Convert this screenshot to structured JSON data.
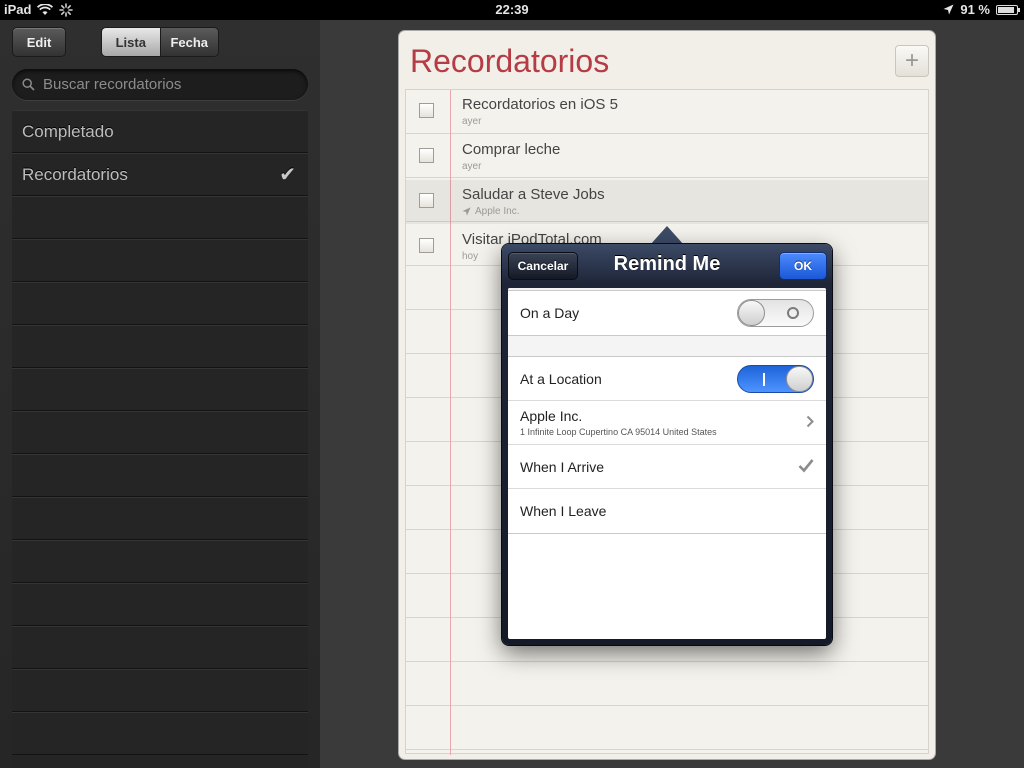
{
  "status_bar": {
    "device": "iPad",
    "time": "22:39",
    "battery": "91 %",
    "battery_level": 0.91
  },
  "sidebar": {
    "edit_label": "Edit",
    "segments": [
      "Lista",
      "Fecha"
    ],
    "search_placeholder": "Buscar recordatorios",
    "lists": [
      {
        "label": "Completado"
      },
      {
        "label": "Recordatorios",
        "selected": true
      }
    ]
  },
  "notepad": {
    "title": "Recordatorios",
    "add_label": "+",
    "reminders": [
      {
        "title": "Recordatorios en iOS 5",
        "subtitle": "ayer"
      },
      {
        "title": "Comprar leche",
        "subtitle": "ayer"
      },
      {
        "title": "Saludar a Steve Jobs",
        "subtitle": "Apple Inc."
      },
      {
        "title": "Visitar iPodTotal.com",
        "subtitle": "hoy"
      }
    ]
  },
  "popover": {
    "title": "Remind Me",
    "cancel_label": "Cancelar",
    "ok_label": "OK",
    "on_a_day": {
      "label": "On a Day",
      "enabled": false
    },
    "at_a_location": {
      "label": "At a Location",
      "enabled": true
    },
    "location": {
      "name": "Apple Inc.",
      "address": "1 Infinite Loop Cupertino CA 95014 United States"
    },
    "when_arrive": {
      "label": "When I Arrive",
      "checked": true
    },
    "when_leave": {
      "label": "When I Leave",
      "checked": false
    }
  },
  "colors": {
    "title_red": "#b63b45",
    "ok_blue": "#1a58d6",
    "switch_on": "#2a6fe8"
  }
}
